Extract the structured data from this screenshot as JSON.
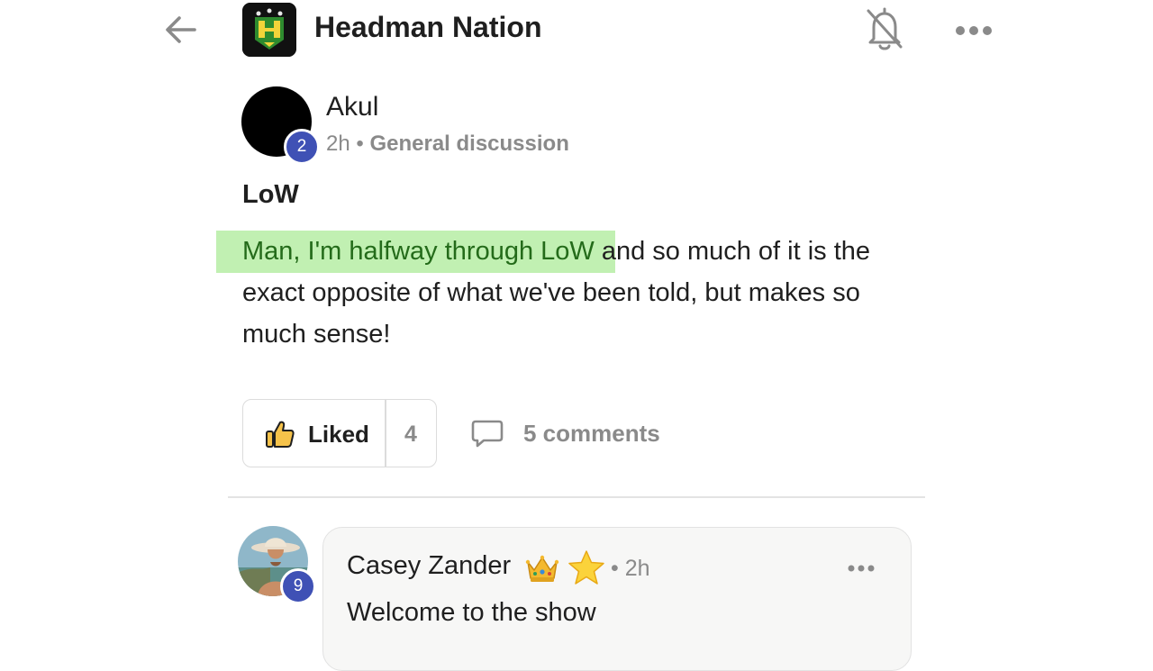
{
  "header": {
    "group_name": "Headman Nation",
    "back_icon": "arrow-left-icon",
    "notification_icon": "bell-off-icon",
    "more_icon": "more-horizontal-icon"
  },
  "post": {
    "author": "Akul",
    "author_level": "2",
    "time": "2h",
    "separator": "•",
    "category": "General discussion",
    "title": "LoW",
    "body_highlighted": "Man, I'm halfway through LoW",
    "body_rest": " and so much of it is the exact opposite of what we've been told, but makes so much sense!",
    "like_label": "Liked",
    "like_count": "4",
    "comments_label": "5 comments"
  },
  "comment": {
    "author": "Casey Zander",
    "author_level": "9",
    "badges": [
      "crown-icon",
      "star-icon"
    ],
    "time": "• 2h",
    "text": "Welcome to the show"
  },
  "colors": {
    "highlight": "#c1f0b2",
    "level_badge": "#3f51b5",
    "muted_text": "#8a8a8a"
  }
}
